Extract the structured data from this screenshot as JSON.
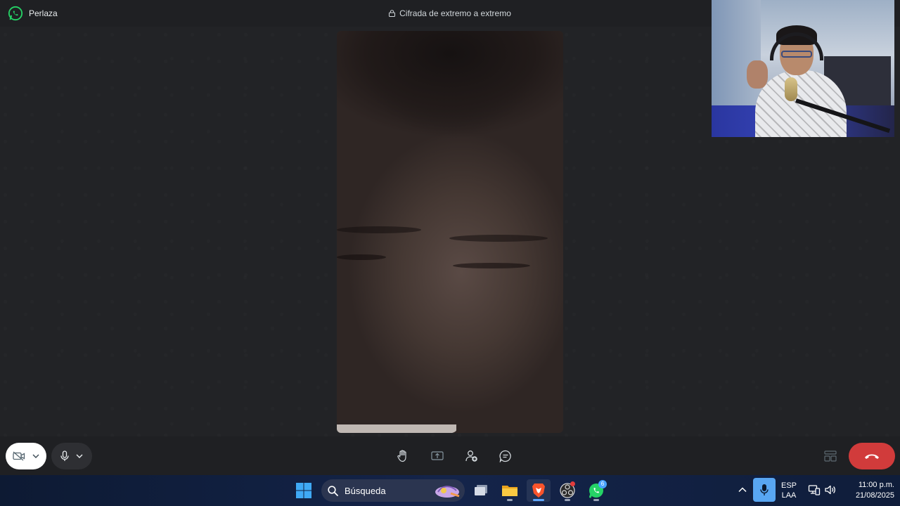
{
  "titlebar": {
    "app_name": "Perlaza",
    "app_icon": "whatsapp-icon",
    "encryption_text": "Cifrada de extremo a extremo",
    "encryption_icon": "lock-icon"
  },
  "controls": {
    "camera_icon": "camera-off-icon",
    "mic_icon": "microphone-icon",
    "raise_hand_icon": "raise-hand-icon",
    "share_screen_icon": "share-screen-icon",
    "add_participant_icon": "add-participant-icon",
    "chat_icon": "chat-icon",
    "layout_icon": "grid-layout-icon",
    "end_call_icon": "end-call-icon",
    "end_call_color": "#d13b3b"
  },
  "taskbar": {
    "search_placeholder": "Búsqueda",
    "whatsapp_badge": "6",
    "apps": [
      "start-icon",
      "task-view-icon",
      "file-explorer-icon",
      "brave-browser-icon",
      "obs-icon",
      "whatsapp-icon"
    ],
    "tray": {
      "lang_line1": "ESP",
      "lang_line2": "LAA",
      "time": "11:00 p.m.",
      "date": "21/08/2025"
    }
  },
  "colors": {
    "background": "#222326",
    "taskbar": "#14244a",
    "accent": "#25d366"
  }
}
